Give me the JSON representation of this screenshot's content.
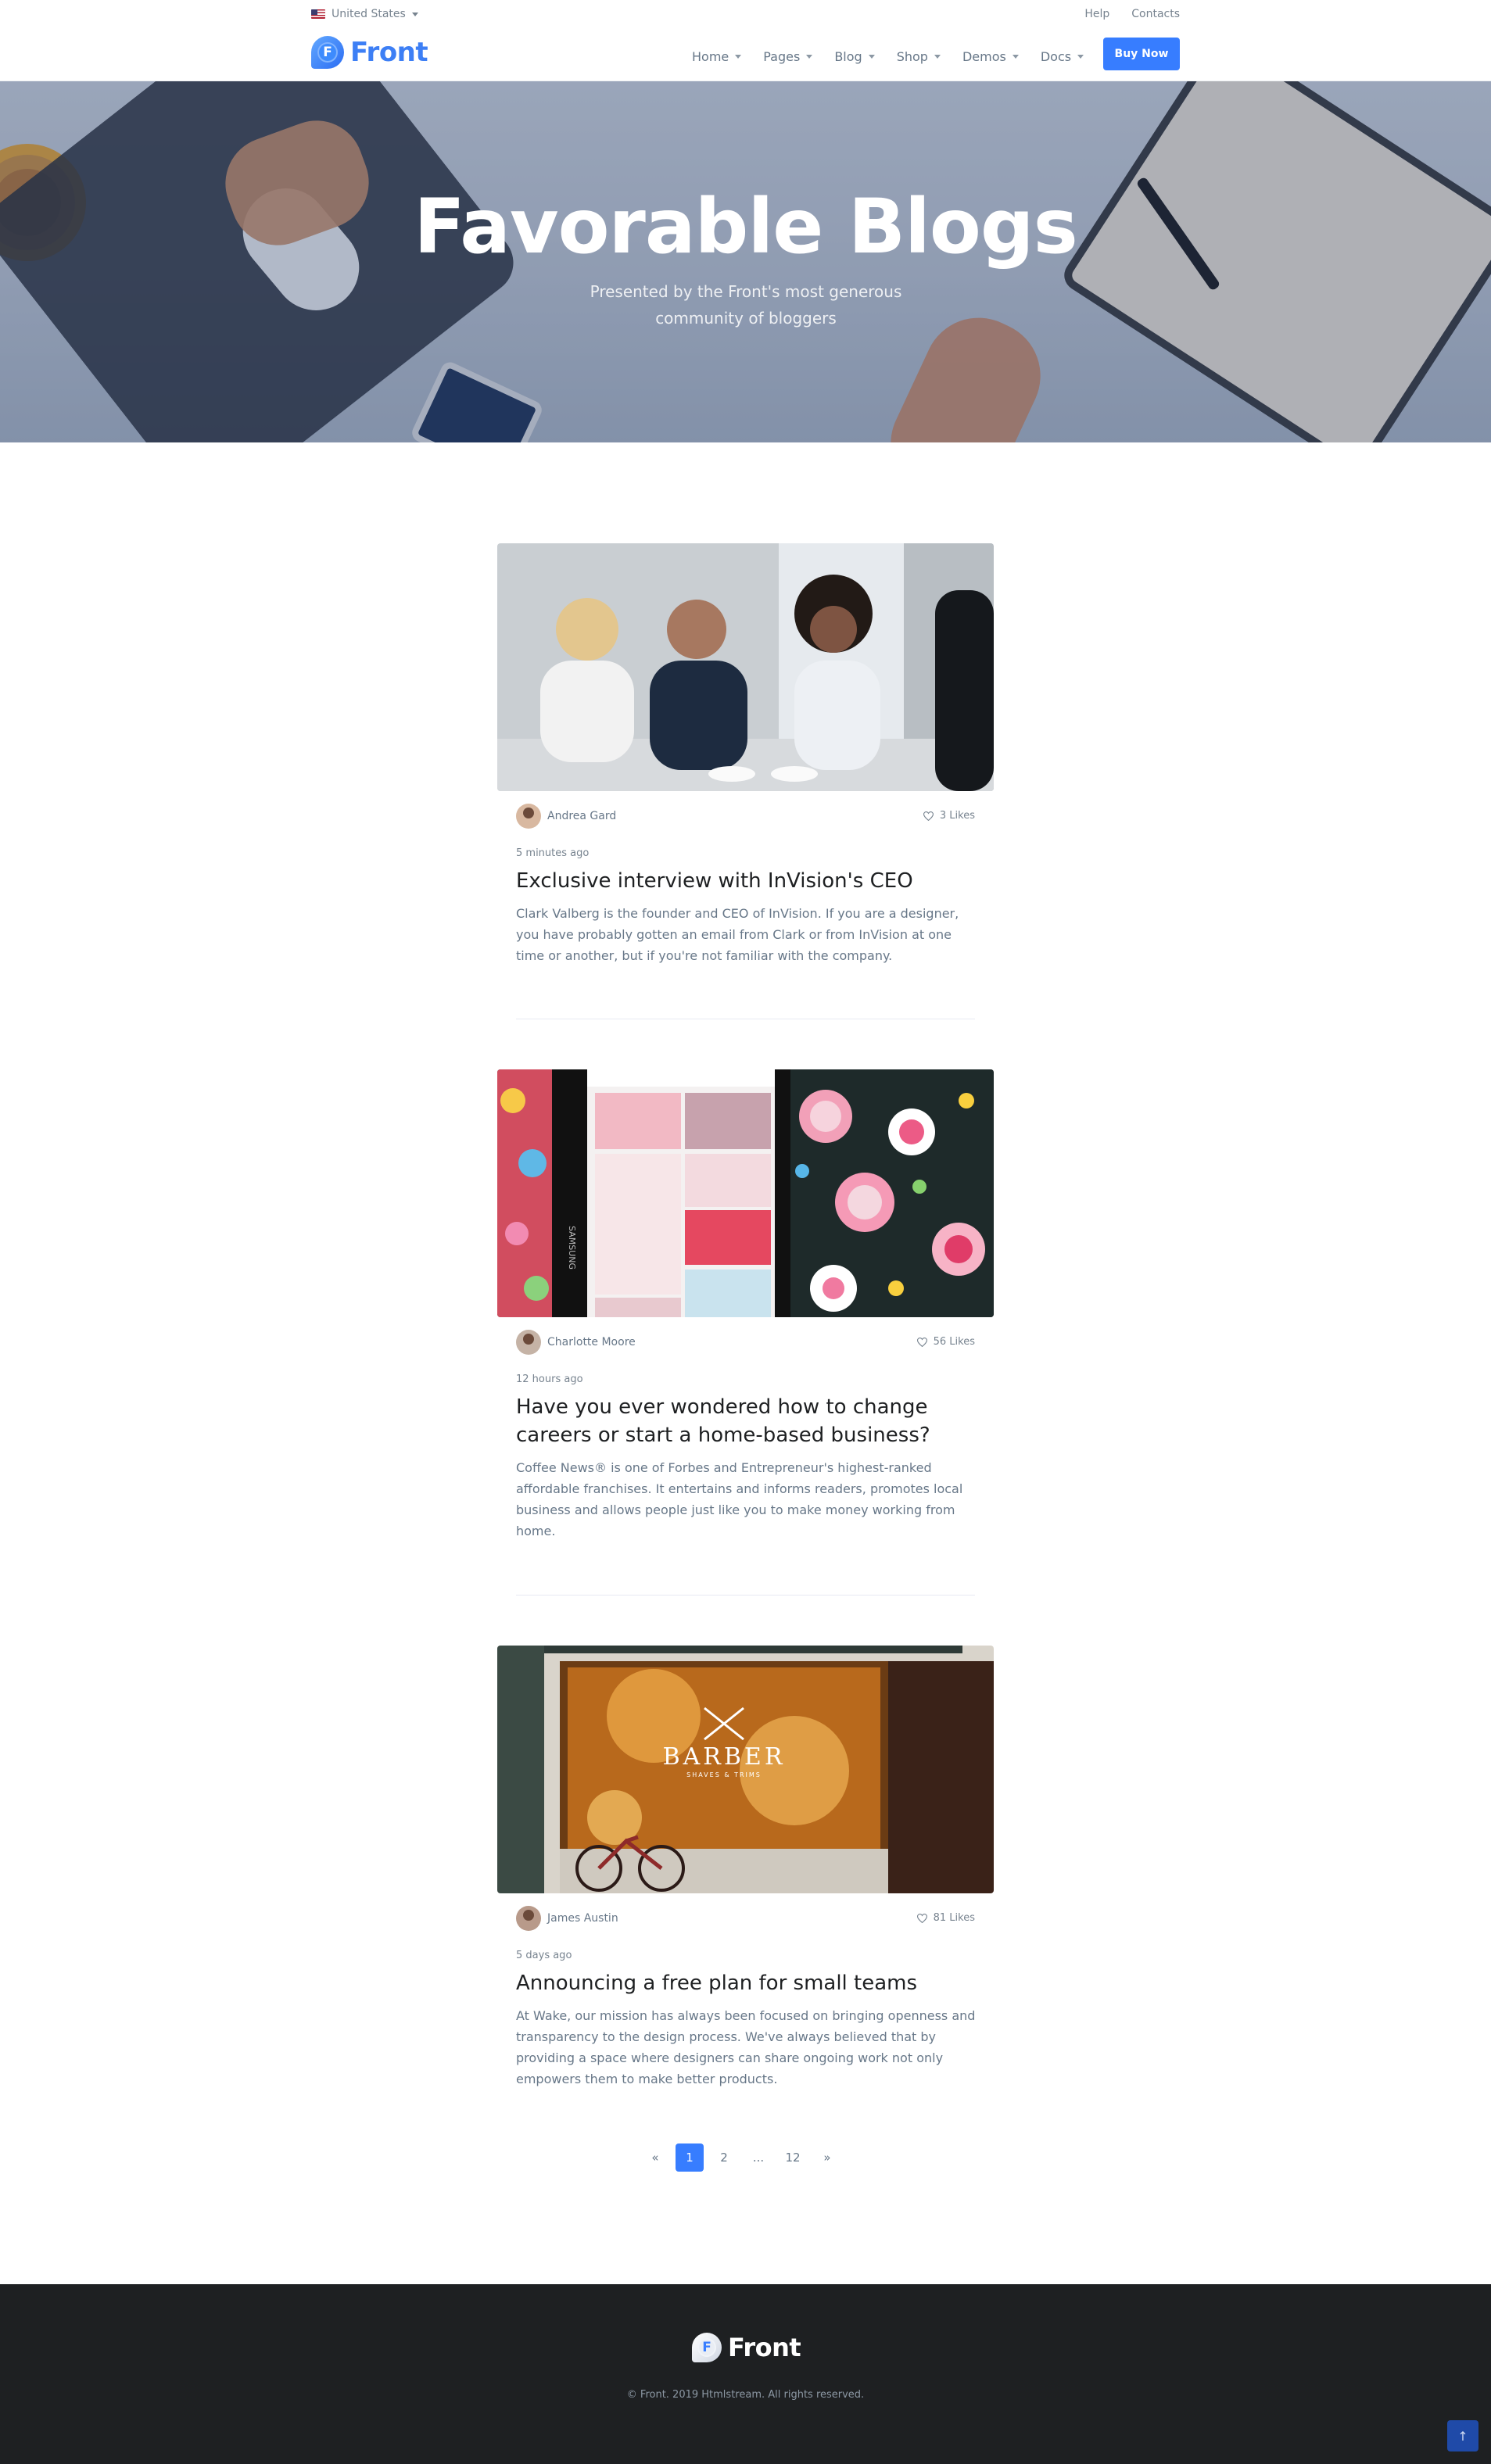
{
  "topbar": {
    "language": "United States",
    "links": [
      "Help",
      "Contacts"
    ]
  },
  "header": {
    "logo_letter": "F",
    "logo_text": "Front",
    "nav": [
      "Home",
      "Pages",
      "Blog",
      "Shop",
      "Demos",
      "Docs"
    ],
    "buy_label": "Buy Now"
  },
  "hero": {
    "title": "Favorable Blogs",
    "subtitle": "Presented by the Front's most generous community of bloggers"
  },
  "posts": [
    {
      "author": "Andrea Gard",
      "likes": "3 Likes",
      "time": "5 minutes ago",
      "title": "Exclusive interview with InVision's CEO",
      "excerpt": "Clark Valberg is the founder and CEO of InVision. If you are a designer, you have probably gotten an email from Clark or from InVision at one time or another, but if you're not familiar with the company."
    },
    {
      "author": "Charlotte Moore",
      "likes": "56 Likes",
      "time": "12 hours ago",
      "title": "Have you ever wondered how to change careers or start a home-based business?",
      "excerpt": "Coffee News® is one of Forbes and Entrepreneur's highest-ranked affordable franchises. It entertains and informs readers, promotes local business and allows people just like you to make money working from home."
    },
    {
      "author": "James Austin",
      "likes": "81 Likes",
      "time": "5 days ago",
      "title": "Announcing a free plan for small teams",
      "excerpt": "At Wake, our mission has always been focused on bringing openness and transparency to the design process. We've always believed that by providing a space where designers can share ongoing work not only empowers them to make better products."
    }
  ],
  "image_text": {
    "phone_brand": "SAMSUNG",
    "barber_sign": "BARBER",
    "barber_tagline": "SHAVES & TRIMS"
  },
  "pagination": [
    "«",
    "1",
    "2",
    "...",
    "12",
    "»"
  ],
  "footer": {
    "logo_letter": "F",
    "logo_text": "Front",
    "copyright": "© Front. 2019 Htmlstream. All rights reserved."
  },
  "back_to_top": "↑",
  "colors": {
    "primary": "#377dff",
    "footer_bg": "#1e2022",
    "text_muted": "#677788"
  }
}
